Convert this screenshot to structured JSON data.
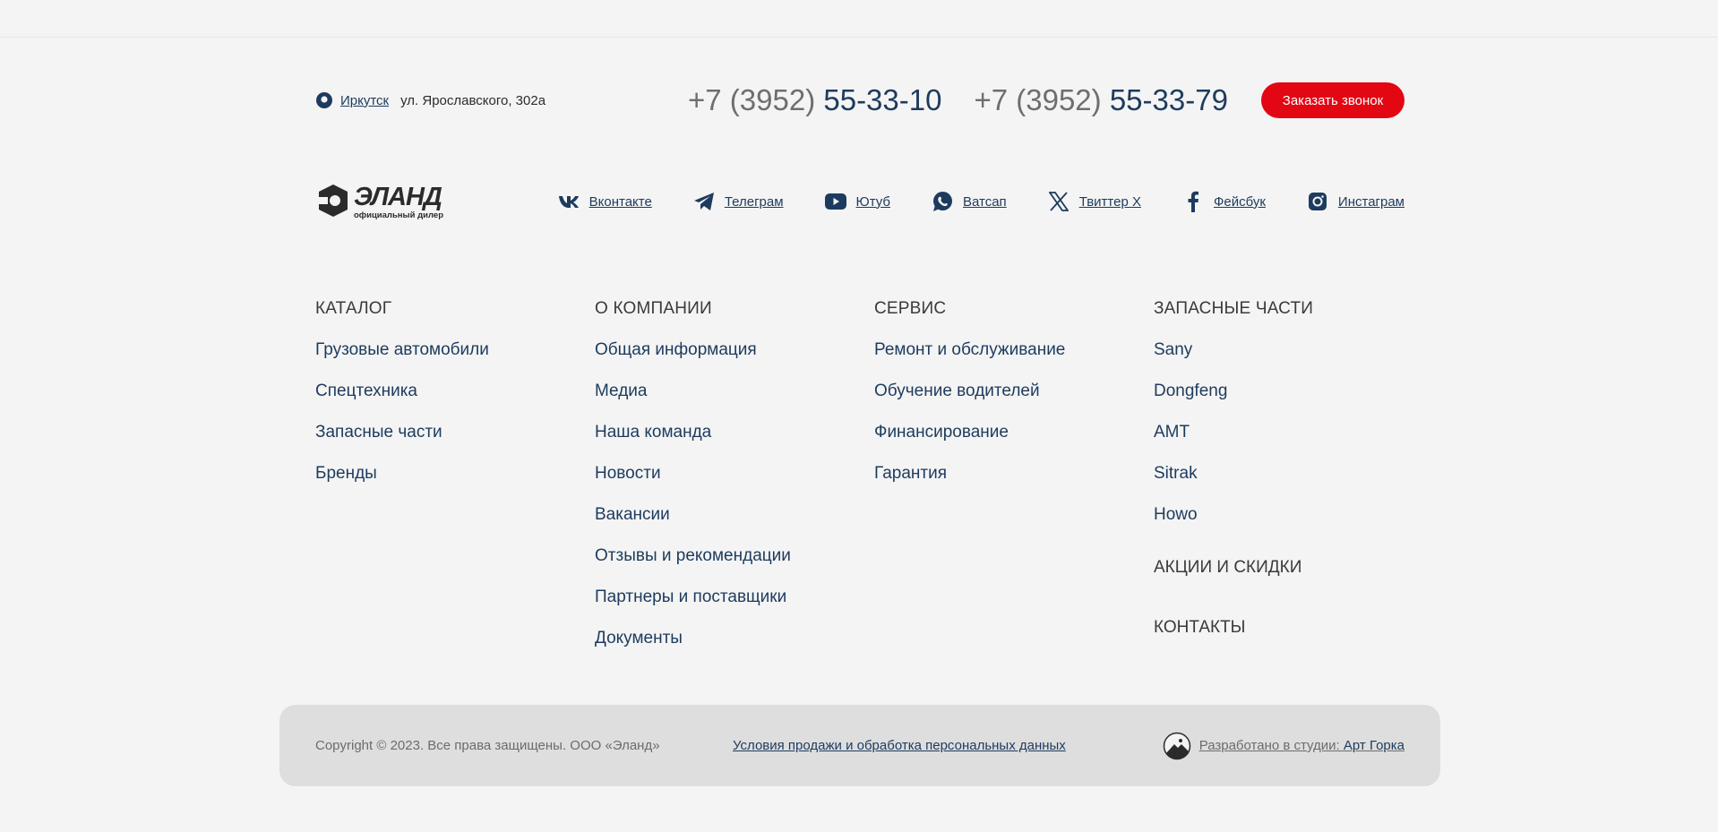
{
  "contact": {
    "city": "Иркутск",
    "address": "ул. Ярославского, 302а",
    "phones": [
      {
        "prefix": "+7 (3952) ",
        "number": "55-33-10"
      },
      {
        "prefix": "+7 (3952) ",
        "number": "55-33-79"
      }
    ],
    "callback_label": "Заказать звонок"
  },
  "brand": {
    "logo_text": "ЭЛАНД",
    "logo_sub": "официальный дилер"
  },
  "socials": [
    {
      "label": "Вконтакте",
      "icon": "vk-icon"
    },
    {
      "label": "Телеграм",
      "icon": "telegram-icon"
    },
    {
      "label": "Ютуб",
      "icon": "youtube-icon"
    },
    {
      "label": "Ватсап",
      "icon": "whatsapp-icon"
    },
    {
      "label": "Твиттер X",
      "icon": "x-twitter-icon"
    },
    {
      "label": "Фейсбук",
      "icon": "facebook-icon"
    },
    {
      "label": "Инстаграм",
      "icon": "instagram-icon"
    }
  ],
  "columns": [
    {
      "title": "КАТАЛОГ",
      "links": [
        "Грузовые автомобили",
        "Спецтехника",
        "Запасные части",
        "Бренды"
      ]
    },
    {
      "title": "О КОМПАНИИ",
      "links": [
        "Общая информация",
        "Медиа",
        "Наша команда",
        "Новости",
        "Вакансии",
        "Отзывы и рекомендации",
        "Партнеры и поставщики",
        "Документы"
      ]
    },
    {
      "title": "СЕРВИС",
      "links": [
        "Ремонт и обслуживание",
        "Обучение водителей",
        "Финансирование",
        "Гарантия"
      ]
    },
    {
      "title": "ЗАПАСНЫЕ ЧАСТИ",
      "links": [
        "Sany",
        "Dongfeng",
        "AMT",
        "Sitrak",
        "Howo"
      ]
    }
  ],
  "extra_sections": [
    "АКЦИИ И СКИДКИ",
    "КОНТАКТЫ"
  ],
  "footer": {
    "copyright": "Copyright © 2023. Все права защищены. ООО «Эланд»",
    "terms": "Условия продажи и обработка персональных данных",
    "dev_prefix": "Разработано в студии: ",
    "dev_studio": "Арт Горка"
  },
  "colors": {
    "accent": "#e30613",
    "link": "#1d3b5e",
    "background": "#f4f4f4",
    "footer_bar": "#dedede"
  }
}
